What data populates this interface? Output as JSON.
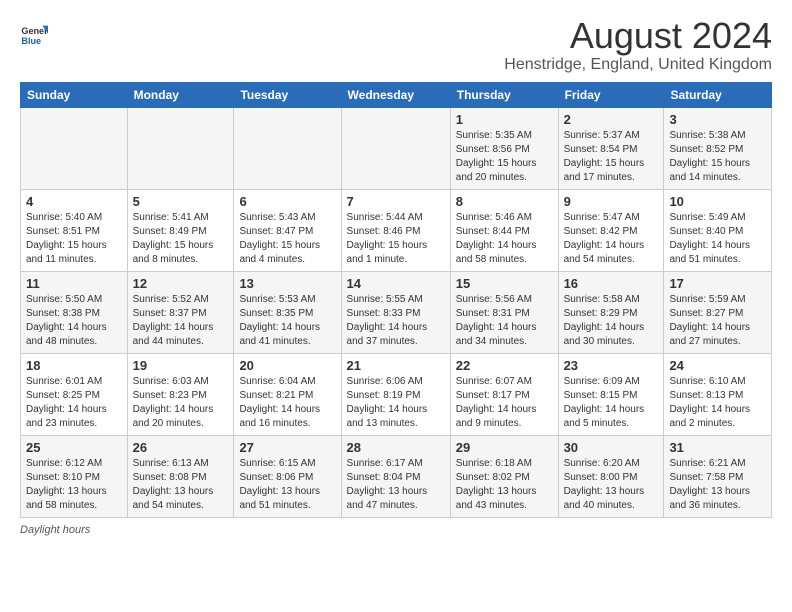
{
  "logo": {
    "text_general": "General",
    "text_blue": "Blue"
  },
  "title": "August 2024",
  "subtitle": "Henstridge, England, United Kingdom",
  "days_of_week": [
    "Sunday",
    "Monday",
    "Tuesday",
    "Wednesday",
    "Thursday",
    "Friday",
    "Saturday"
  ],
  "footer_label": "Daylight hours",
  "weeks": [
    [
      {
        "day": "",
        "sunrise": "",
        "sunset": "",
        "daylight": ""
      },
      {
        "day": "",
        "sunrise": "",
        "sunset": "",
        "daylight": ""
      },
      {
        "day": "",
        "sunrise": "",
        "sunset": "",
        "daylight": ""
      },
      {
        "day": "",
        "sunrise": "",
        "sunset": "",
        "daylight": ""
      },
      {
        "day": "1",
        "sunrise": "Sunrise: 5:35 AM",
        "sunset": "Sunset: 8:56 PM",
        "daylight": "Daylight: 15 hours and 20 minutes."
      },
      {
        "day": "2",
        "sunrise": "Sunrise: 5:37 AM",
        "sunset": "Sunset: 8:54 PM",
        "daylight": "Daylight: 15 hours and 17 minutes."
      },
      {
        "day": "3",
        "sunrise": "Sunrise: 5:38 AM",
        "sunset": "Sunset: 8:52 PM",
        "daylight": "Daylight: 15 hours and 14 minutes."
      }
    ],
    [
      {
        "day": "4",
        "sunrise": "Sunrise: 5:40 AM",
        "sunset": "Sunset: 8:51 PM",
        "daylight": "Daylight: 15 hours and 11 minutes."
      },
      {
        "day": "5",
        "sunrise": "Sunrise: 5:41 AM",
        "sunset": "Sunset: 8:49 PM",
        "daylight": "Daylight: 15 hours and 8 minutes."
      },
      {
        "day": "6",
        "sunrise": "Sunrise: 5:43 AM",
        "sunset": "Sunset: 8:47 PM",
        "daylight": "Daylight: 15 hours and 4 minutes."
      },
      {
        "day": "7",
        "sunrise": "Sunrise: 5:44 AM",
        "sunset": "Sunset: 8:46 PM",
        "daylight": "Daylight: 15 hours and 1 minute."
      },
      {
        "day": "8",
        "sunrise": "Sunrise: 5:46 AM",
        "sunset": "Sunset: 8:44 PM",
        "daylight": "Daylight: 14 hours and 58 minutes."
      },
      {
        "day": "9",
        "sunrise": "Sunrise: 5:47 AM",
        "sunset": "Sunset: 8:42 PM",
        "daylight": "Daylight: 14 hours and 54 minutes."
      },
      {
        "day": "10",
        "sunrise": "Sunrise: 5:49 AM",
        "sunset": "Sunset: 8:40 PM",
        "daylight": "Daylight: 14 hours and 51 minutes."
      }
    ],
    [
      {
        "day": "11",
        "sunrise": "Sunrise: 5:50 AM",
        "sunset": "Sunset: 8:38 PM",
        "daylight": "Daylight: 14 hours and 48 minutes."
      },
      {
        "day": "12",
        "sunrise": "Sunrise: 5:52 AM",
        "sunset": "Sunset: 8:37 PM",
        "daylight": "Daylight: 14 hours and 44 minutes."
      },
      {
        "day": "13",
        "sunrise": "Sunrise: 5:53 AM",
        "sunset": "Sunset: 8:35 PM",
        "daylight": "Daylight: 14 hours and 41 minutes."
      },
      {
        "day": "14",
        "sunrise": "Sunrise: 5:55 AM",
        "sunset": "Sunset: 8:33 PM",
        "daylight": "Daylight: 14 hours and 37 minutes."
      },
      {
        "day": "15",
        "sunrise": "Sunrise: 5:56 AM",
        "sunset": "Sunset: 8:31 PM",
        "daylight": "Daylight: 14 hours and 34 minutes."
      },
      {
        "day": "16",
        "sunrise": "Sunrise: 5:58 AM",
        "sunset": "Sunset: 8:29 PM",
        "daylight": "Daylight: 14 hours and 30 minutes."
      },
      {
        "day": "17",
        "sunrise": "Sunrise: 5:59 AM",
        "sunset": "Sunset: 8:27 PM",
        "daylight": "Daylight: 14 hours and 27 minutes."
      }
    ],
    [
      {
        "day": "18",
        "sunrise": "Sunrise: 6:01 AM",
        "sunset": "Sunset: 8:25 PM",
        "daylight": "Daylight: 14 hours and 23 minutes."
      },
      {
        "day": "19",
        "sunrise": "Sunrise: 6:03 AM",
        "sunset": "Sunset: 8:23 PM",
        "daylight": "Daylight: 14 hours and 20 minutes."
      },
      {
        "day": "20",
        "sunrise": "Sunrise: 6:04 AM",
        "sunset": "Sunset: 8:21 PM",
        "daylight": "Daylight: 14 hours and 16 minutes."
      },
      {
        "day": "21",
        "sunrise": "Sunrise: 6:06 AM",
        "sunset": "Sunset: 8:19 PM",
        "daylight": "Daylight: 14 hours and 13 minutes."
      },
      {
        "day": "22",
        "sunrise": "Sunrise: 6:07 AM",
        "sunset": "Sunset: 8:17 PM",
        "daylight": "Daylight: 14 hours and 9 minutes."
      },
      {
        "day": "23",
        "sunrise": "Sunrise: 6:09 AM",
        "sunset": "Sunset: 8:15 PM",
        "daylight": "Daylight: 14 hours and 5 minutes."
      },
      {
        "day": "24",
        "sunrise": "Sunrise: 6:10 AM",
        "sunset": "Sunset: 8:13 PM",
        "daylight": "Daylight: 14 hours and 2 minutes."
      }
    ],
    [
      {
        "day": "25",
        "sunrise": "Sunrise: 6:12 AM",
        "sunset": "Sunset: 8:10 PM",
        "daylight": "Daylight: 13 hours and 58 minutes."
      },
      {
        "day": "26",
        "sunrise": "Sunrise: 6:13 AM",
        "sunset": "Sunset: 8:08 PM",
        "daylight": "Daylight: 13 hours and 54 minutes."
      },
      {
        "day": "27",
        "sunrise": "Sunrise: 6:15 AM",
        "sunset": "Sunset: 8:06 PM",
        "daylight": "Daylight: 13 hours and 51 minutes."
      },
      {
        "day": "28",
        "sunrise": "Sunrise: 6:17 AM",
        "sunset": "Sunset: 8:04 PM",
        "daylight": "Daylight: 13 hours and 47 minutes."
      },
      {
        "day": "29",
        "sunrise": "Sunrise: 6:18 AM",
        "sunset": "Sunset: 8:02 PM",
        "daylight": "Daylight: 13 hours and 43 minutes."
      },
      {
        "day": "30",
        "sunrise": "Sunrise: 6:20 AM",
        "sunset": "Sunset: 8:00 PM",
        "daylight": "Daylight: 13 hours and 40 minutes."
      },
      {
        "day": "31",
        "sunrise": "Sunrise: 6:21 AM",
        "sunset": "Sunset: 7:58 PM",
        "daylight": "Daylight: 13 hours and 36 minutes."
      }
    ]
  ]
}
